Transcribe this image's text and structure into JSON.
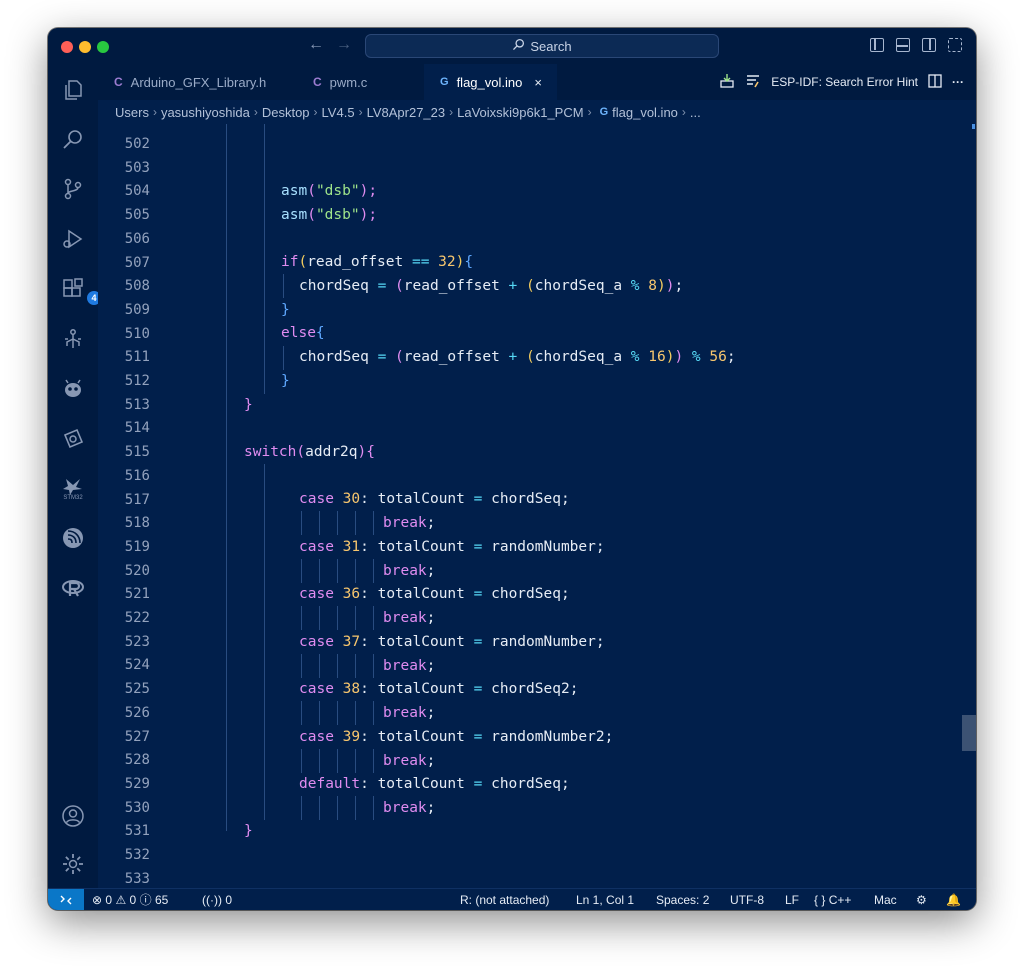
{
  "window": {
    "search_label": "Search"
  },
  "activity_bar": {
    "extensions_badge": "4",
    "stm32_label": "STM32"
  },
  "tabs": [
    {
      "icon": "C",
      "label": "Arduino_GFX_Library.h"
    },
    {
      "icon": "C",
      "label": "pwm.c"
    },
    {
      "icon": "G",
      "label": "flag_vol.ino",
      "close": "×"
    }
  ],
  "esp_idf": {
    "label": "ESP-IDF: Search Error Hint",
    "more": "···"
  },
  "breadcrumb": [
    "Users",
    "yasushiyoshida",
    "Desktop",
    "LV4.5",
    "LV8Apr27_23",
    "LaVoixski9p6k1_PCM",
    "flag_vol.ino",
    "..."
  ],
  "line_numbers": [
    "502",
    "503",
    "504",
    "505",
    "506",
    "507",
    "508",
    "509",
    "510",
    "511",
    "512",
    "513",
    "514",
    "515",
    "516",
    "517",
    "518",
    "519",
    "520",
    "521",
    "522",
    "523",
    "524",
    "525",
    "526",
    "527",
    "528",
    "529",
    "530",
    "531",
    "532",
    "533"
  ],
  "code": {
    "l503": {
      "fn": "asm",
      "po": "(",
      "str": "\"dsb\"",
      "pc": ");"
    },
    "l504": {
      "fn": "asm",
      "po": "(",
      "str": "\"dsb\"",
      "pc": ");"
    },
    "l506": {
      "kw": "if",
      "po": "(",
      "var": "read_offset ",
      "op": "==",
      "num": " 32",
      "pc": ")",
      "brace": "{"
    },
    "l507": {
      "var": "chordSeq ",
      "eq": "=",
      "p1": " (",
      "var2": "read_offset ",
      "op": "+",
      "p2": " (",
      "var3": "chordSeq_a ",
      "op2": "%",
      "num": " 8",
      "p2c": ")",
      "p1c": ")",
      "semi": ";"
    },
    "l508": {
      "brace": "}"
    },
    "l509": {
      "kw": "else",
      "brace": "{"
    },
    "l510": {
      "var": "chordSeq ",
      "eq": "=",
      "p1": " (",
      "var2": "read_offset ",
      "op": "+",
      "p2": " (",
      "var3": "chordSeq_a ",
      "op2": "%",
      "num": " 16",
      "p2c": ")",
      "p1c": ")",
      "op3": " %",
      "num2": " 56",
      "semi": ";"
    },
    "l511": {
      "brace": "}"
    },
    "l512": {
      "brace": "}"
    },
    "l514": {
      "kw": "switch",
      "po": "(",
      "var": "addr2q",
      "pc": ")",
      "brace": "{"
    },
    "cases": [
      {
        "kw": "case",
        "num": "30",
        "target": "totalCount",
        "value": "chordSeq"
      },
      {
        "kw": "case",
        "num": "31",
        "target": "totalCount",
        "value": "randomNumber"
      },
      {
        "kw": "case",
        "num": "36",
        "target": "totalCount",
        "value": "chordSeq"
      },
      {
        "kw": "case",
        "num": "37",
        "target": "totalCount",
        "value": "randomNumber"
      },
      {
        "kw": "case",
        "num": "38",
        "target": "totalCount",
        "value": "chordSeq2"
      },
      {
        "kw": "case",
        "num": "39",
        "target": "totalCount",
        "value": "randomNumber2"
      }
    ],
    "default": {
      "kw": "default",
      "target": "totalCount",
      "value": "chordSeq"
    },
    "break_kw": "break",
    "assign_op": "=",
    "colon": ":",
    "semi": ";",
    "l530": {
      "brace": "}"
    }
  },
  "status_bar": {
    "errors": "0",
    "warnings": "0",
    "infos": "65",
    "ports": "0",
    "debugger": "R: (not attached)",
    "cursor": "Ln 1, Col 1",
    "indent": "Spaces: 2",
    "encoding": "UTF-8",
    "eol": "LF",
    "language": "C++",
    "platform": "Mac"
  },
  "colors": {
    "editor_bg": "#011f4b",
    "chrome_bg": "#001a40",
    "keyword": "#e08cf0",
    "number": "#f7c66e",
    "string": "#9fe48a",
    "remote_button": "#0a77c8"
  }
}
